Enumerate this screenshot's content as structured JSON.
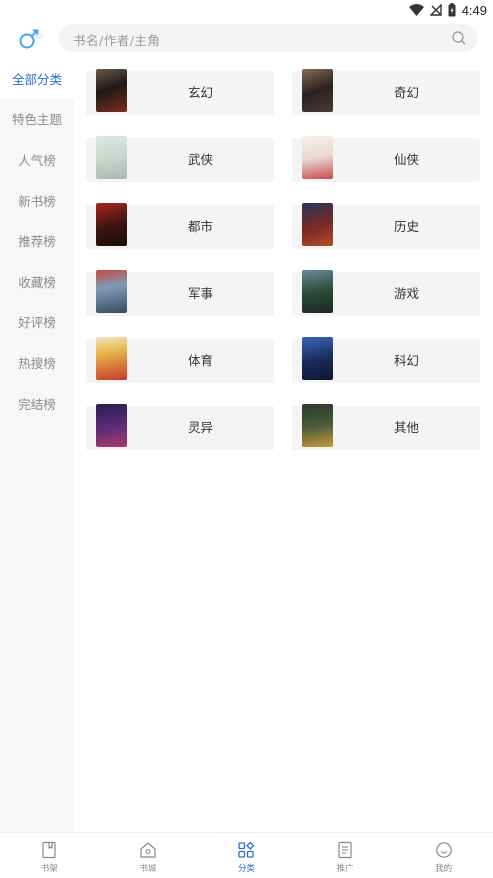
{
  "status_bar": {
    "time": "4:49",
    "icons": [
      "wifi-icon",
      "no-signal-icon",
      "battery-icon"
    ]
  },
  "header": {
    "gender_icon": "male-icon",
    "search": {
      "placeholder": "书名/作者/主角",
      "icon": "search-icon"
    }
  },
  "sidebar": {
    "items": [
      {
        "label": "全部分类",
        "active": true
      },
      {
        "label": "特色主题",
        "active": false
      },
      {
        "label": "人气榜",
        "active": false
      },
      {
        "label": "新书榜",
        "active": false
      },
      {
        "label": "推荐榜",
        "active": false
      },
      {
        "label": "收藏榜",
        "active": false
      },
      {
        "label": "好评榜",
        "active": false
      },
      {
        "label": "热搜榜",
        "active": false
      },
      {
        "label": "完结榜",
        "active": false
      }
    ]
  },
  "categories": [
    {
      "label": "玄幻"
    },
    {
      "label": "奇幻"
    },
    {
      "label": "武侠"
    },
    {
      "label": "仙侠"
    },
    {
      "label": "都市"
    },
    {
      "label": "历史"
    },
    {
      "label": "军事"
    },
    {
      "label": "游戏"
    },
    {
      "label": "体育"
    },
    {
      "label": "科幻"
    },
    {
      "label": "灵异"
    },
    {
      "label": "其他"
    }
  ],
  "bottom_nav": {
    "items": [
      {
        "label": "书架",
        "icon": "bookshelf-icon",
        "active": false
      },
      {
        "label": "书城",
        "icon": "bookstore-icon",
        "active": false
      },
      {
        "label": "分类",
        "icon": "category-icon",
        "active": true
      },
      {
        "label": "推广",
        "icon": "promotion-icon",
        "active": false
      },
      {
        "label": "我的",
        "icon": "profile-icon",
        "active": false
      }
    ]
  },
  "colors": {
    "accent": "#2f6bd8",
    "gender_icon": "#4aa3e8",
    "sidebar_bg": "#f7f7f7",
    "card_bg": "#f4f4f4"
  }
}
